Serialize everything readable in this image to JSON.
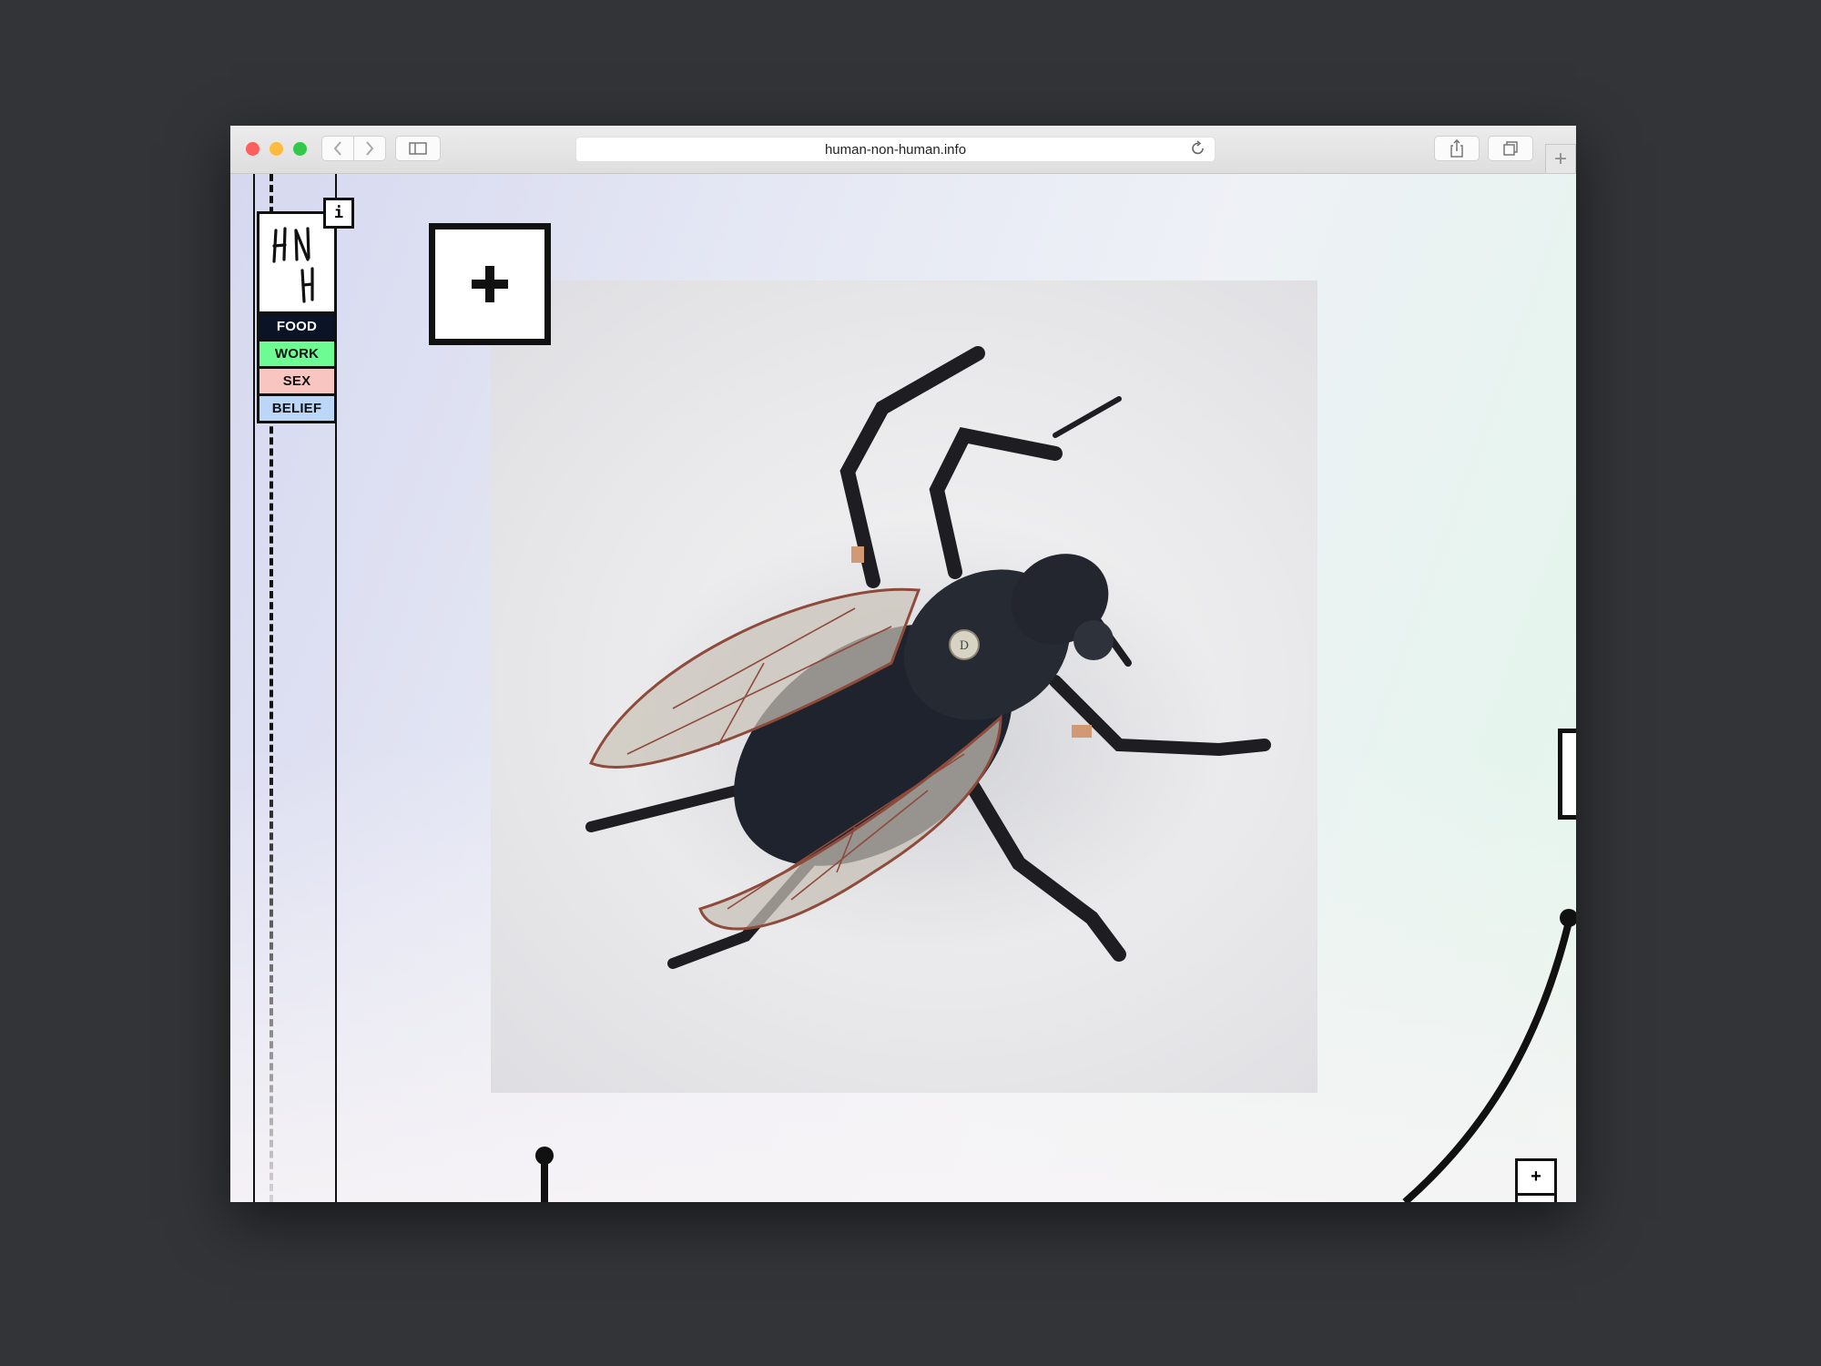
{
  "browser": {
    "url": "human-non-human.info",
    "back_icon": "chevron-left-icon",
    "forward_icon": "chevron-right-icon",
    "sidebar_icon": "sidebar-icon",
    "share_icon": "share-icon",
    "tabs_icon": "tabs-icon",
    "new_tab_label": "+",
    "reload_icon": "reload-icon"
  },
  "site": {
    "info_label": "i",
    "nav": [
      {
        "label": "FOOD",
        "color": "#0b1326"
      },
      {
        "label": "WORK",
        "color": "#6dfb94"
      },
      {
        "label": "SEX",
        "color": "#f8c5c1"
      },
      {
        "label": "BELIEF",
        "color": "#bcd6f7"
      }
    ],
    "zoom_in_label": "+",
    "zoom_out_label": "-",
    "expand_icon": "plus-icon",
    "photo_label": "D"
  },
  "colors": {
    "frame_bg": "#323437",
    "ink": "#111111"
  }
}
